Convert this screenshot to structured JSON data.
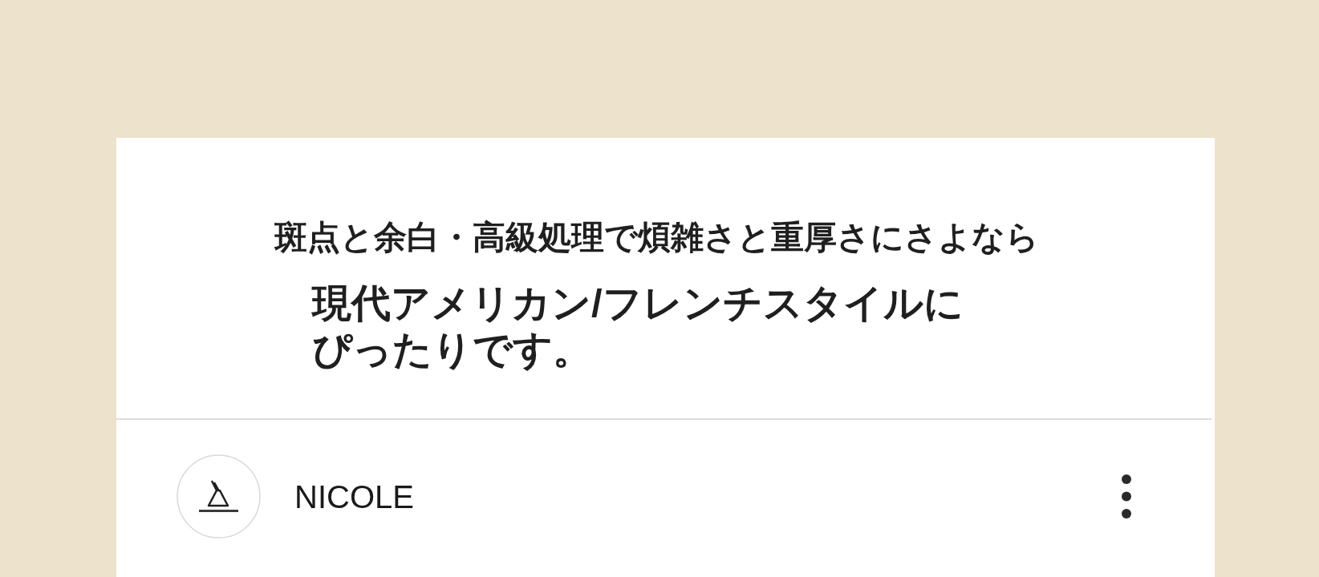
{
  "banner": {
    "tagline": "斑点と余白・高級処理で煩雑さと重厚さにさよなら",
    "headline": "現代アメリカン/フレンチスタイルにぴったりです。"
  },
  "post_header": {
    "author": "NICOLE"
  }
}
